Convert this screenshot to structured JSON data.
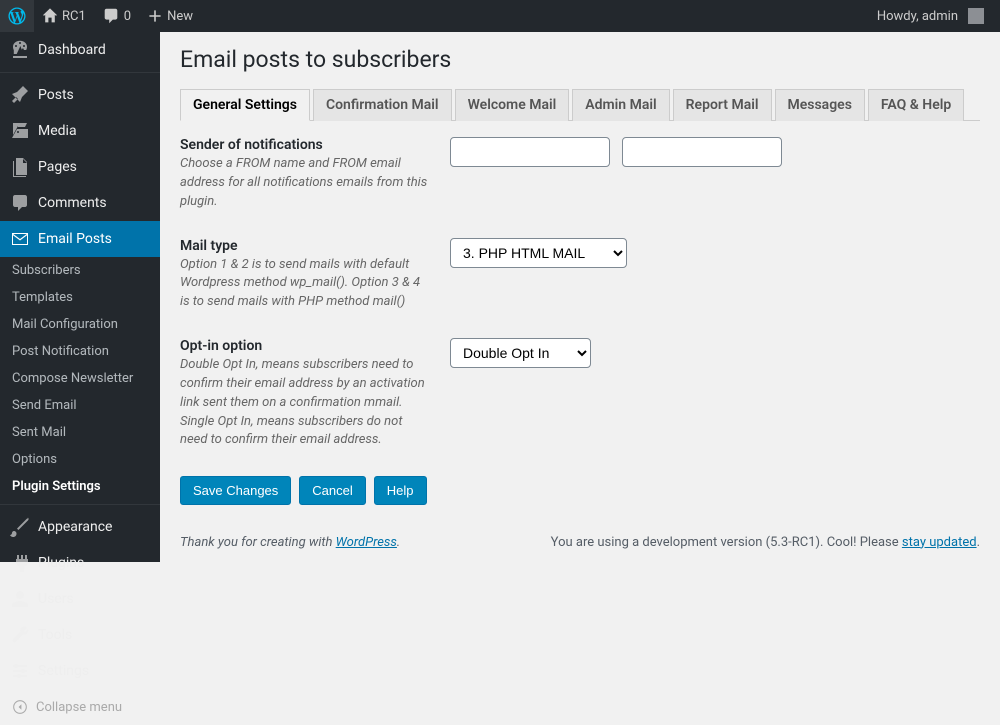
{
  "adminbar": {
    "site_name": "RC1",
    "comments_count": "0",
    "new_label": "New",
    "howdy": "Howdy, admin"
  },
  "sidebar": {
    "items": [
      {
        "label": "Dashboard",
        "icon": "dashboard"
      },
      {
        "label": "Posts",
        "icon": "pin"
      },
      {
        "label": "Media",
        "icon": "media"
      },
      {
        "label": "Pages",
        "icon": "page"
      },
      {
        "label": "Comments",
        "icon": "comment"
      },
      {
        "label": "Email Posts",
        "icon": "mail",
        "current": true
      },
      {
        "label": "Appearance",
        "icon": "brush"
      },
      {
        "label": "Plugins",
        "icon": "plug"
      },
      {
        "label": "Users",
        "icon": "user"
      },
      {
        "label": "Tools",
        "icon": "wrench"
      },
      {
        "label": "Settings",
        "icon": "sliders"
      }
    ],
    "submenu": [
      {
        "label": "Subscribers"
      },
      {
        "label": "Templates"
      },
      {
        "label": "Mail Configuration"
      },
      {
        "label": "Post Notification"
      },
      {
        "label": "Compose Newsletter"
      },
      {
        "label": "Send Email"
      },
      {
        "label": "Sent Mail"
      },
      {
        "label": "Options"
      },
      {
        "label": "Plugin Settings",
        "current": true
      }
    ],
    "collapse": "Collapse menu"
  },
  "page": {
    "title": "Email posts to subscribers",
    "tabs": [
      {
        "label": "General Settings",
        "active": true
      },
      {
        "label": "Confirmation Mail"
      },
      {
        "label": "Welcome Mail"
      },
      {
        "label": "Admin Mail"
      },
      {
        "label": "Report Mail"
      },
      {
        "label": "Messages"
      },
      {
        "label": "FAQ & Help"
      }
    ],
    "fields": {
      "sender": {
        "label": "Sender of notifications",
        "desc": "Choose a FROM name and FROM email address for all notifications emails from this plugin.",
        "from_name": "",
        "from_email": ""
      },
      "mailtype": {
        "label": "Mail type",
        "desc": "Option 1 & 2 is to send mails with default Wordpress method wp_mail(). Option 3 & 4 is to send mails with PHP method mail()",
        "value": "3. PHP HTML MAIL"
      },
      "optin": {
        "label": "Opt-in option",
        "desc": "Double Opt In, means subscribers need to confirm their email address by an activation link sent them on a confirmation mmail. Single Opt In, means subscribers do not need to confirm their email address.",
        "value": "Double Opt In"
      }
    },
    "buttons": {
      "save": "Save Changes",
      "cancel": "Cancel",
      "help": "Help"
    }
  },
  "footer": {
    "left_pre": "Thank you for creating with ",
    "left_link": "WordPress",
    "left_post": ".",
    "right_pre": "You are using a development version (5.3-RC1). Cool! Please ",
    "right_link": "stay updated",
    "right_post": "."
  }
}
